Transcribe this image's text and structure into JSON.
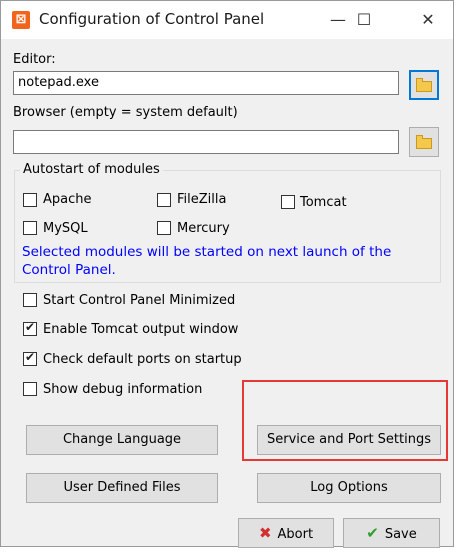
{
  "window": {
    "title": "Configuration of Control Panel",
    "app_icon_glyph": "⊠",
    "minimize_glyph": "—",
    "maximize_glyph": "☐",
    "close_glyph": "✕"
  },
  "editor": {
    "label": "Editor:",
    "value": "notepad.exe"
  },
  "browser": {
    "label": "Browser (empty = system default)",
    "value": ""
  },
  "autostart": {
    "title": "Autostart of modules",
    "modules": [
      {
        "label": "Apache",
        "checked": false
      },
      {
        "label": "FileZilla",
        "checked": false
      },
      {
        "label": "Tomcat",
        "checked": false
      },
      {
        "label": "MySQL",
        "checked": false
      },
      {
        "label": "Mercury",
        "checked": false
      }
    ],
    "note": "Selected modules will be started on next launch of the Control Panel.",
    "note_color": "#0000ff"
  },
  "options": [
    {
      "label": "Start Control Panel Minimized",
      "checked": false
    },
    {
      "label": "Enable Tomcat output window",
      "checked": true
    },
    {
      "label": "Check default ports on startup",
      "checked": true
    },
    {
      "label": "Show debug information",
      "checked": false
    }
  ],
  "buttons": {
    "change_language": "Change Language",
    "service_port_settings": "Service and Port Settings",
    "user_defined_files": "User Defined Files",
    "log_options": "Log Options",
    "abort": "Abort",
    "save": "Save"
  },
  "icons": {
    "check_mark": "✔",
    "abort": "✖",
    "save": "✔"
  },
  "colors": {
    "highlight_box": "#e53935",
    "focus_border": "#0078d7"
  }
}
